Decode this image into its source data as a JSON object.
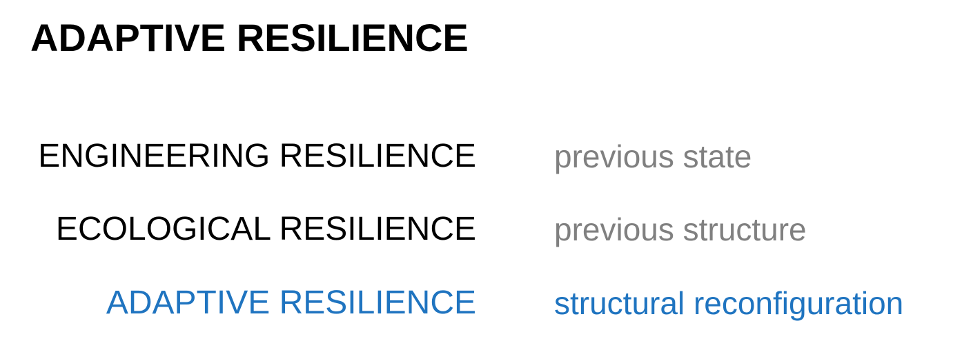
{
  "title": "ADAPTIVE RESILIENCE",
  "colors": {
    "text": "#000000",
    "muted": "#808080",
    "accent": "#1f74c0"
  },
  "rows": [
    {
      "term": "ENGINEERING RESILIENCE",
      "description": "previous state"
    },
    {
      "term": "ECOLOGICAL RESILIENCE",
      "description": "previous structure"
    },
    {
      "term": "ADAPTIVE RESILIENCE",
      "description": "structural reconfiguration"
    }
  ]
}
